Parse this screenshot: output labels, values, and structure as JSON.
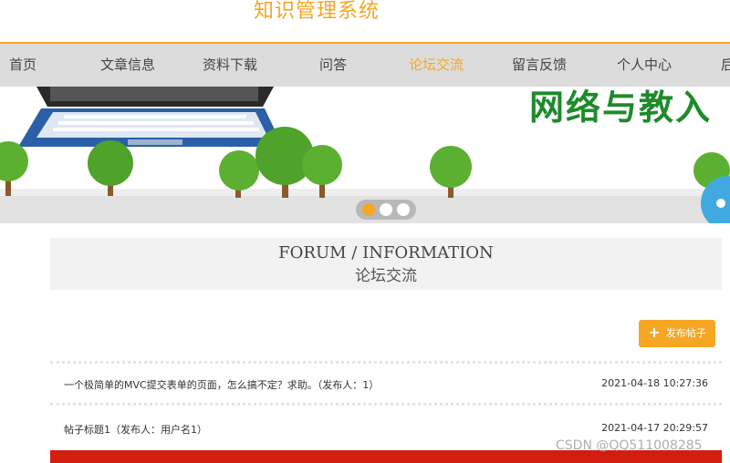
{
  "header": {
    "site_title": "知识管理系统"
  },
  "nav": {
    "items": [
      {
        "label": "首页"
      },
      {
        "label": "文章信息"
      },
      {
        "label": "资料下载"
      },
      {
        "label": "问答"
      },
      {
        "label": "论坛交流"
      },
      {
        "label": "留言反馈"
      },
      {
        "label": "个人中心"
      },
      {
        "label": "后"
      }
    ],
    "active_index": 4
  },
  "banner": {
    "text": "网络与教入",
    "slide_count": 3,
    "active_slide": 1
  },
  "section": {
    "title_en": "FORUM / INFORMATION",
    "title_cn": "论坛交流"
  },
  "post_button": {
    "label": "发布帖子"
  },
  "posts": [
    {
      "title": "一个极简单的MVC提交表单的页面，怎么搞不定？求助。（发布人：1）",
      "time": "2021-04-18 10:27:36"
    },
    {
      "title": "帖子标题1（发布人：用户名1）",
      "time": "2021-04-17 20:29:57"
    }
  ],
  "watermark": "CSDN @QQ511008285",
  "colors": {
    "accent": "#f5a623",
    "nav_bg": "#dcdcdc",
    "banner_bar": "#d31d0e",
    "text_green": "#1e8b2b"
  }
}
